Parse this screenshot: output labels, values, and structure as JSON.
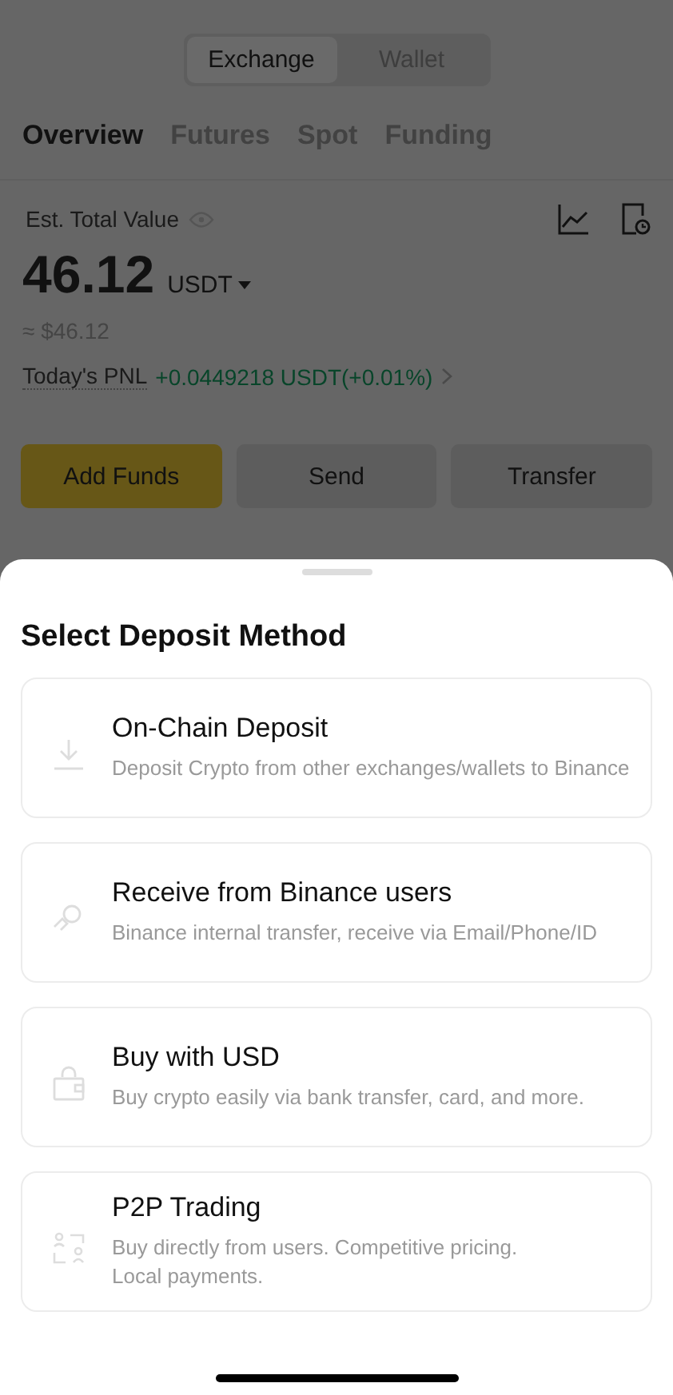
{
  "segment": [
    {
      "label": "Exchange",
      "selected": true
    },
    {
      "label": "Wallet",
      "selected": false
    }
  ],
  "tabs": [
    {
      "label": "Overview",
      "selected": true
    },
    {
      "label": "Futures",
      "selected": false
    },
    {
      "label": "Spot",
      "selected": false
    },
    {
      "label": "Funding",
      "selected": false
    }
  ],
  "balance": {
    "label": "Est. Total Value",
    "amount": "46.12",
    "currency": "USDT",
    "fiat": "≈ $46.12",
    "pnl_label": "Today's PNL",
    "pnl_value": "+0.0449218 USDT(+0.01%)"
  },
  "actions": [
    {
      "label": "Add Funds",
      "primary": true
    },
    {
      "label": "Send",
      "primary": false
    },
    {
      "label": "Transfer",
      "primary": false
    }
  ],
  "sheet": {
    "title": "Select Deposit Method",
    "methods": [
      {
        "title": "On-Chain Deposit",
        "description": "Deposit Crypto from other exchanges/wallets to Binance"
      },
      {
        "title": "Receive from Binance users",
        "description": "Binance internal transfer, receive via Email/Phone/ID"
      },
      {
        "title": "Buy with USD",
        "description": "Buy crypto easily via bank transfer, card, and more."
      },
      {
        "title": "P2P Trading",
        "description": "Buy directly from users. Competitive pricing.\nLocal payments."
      }
    ]
  }
}
